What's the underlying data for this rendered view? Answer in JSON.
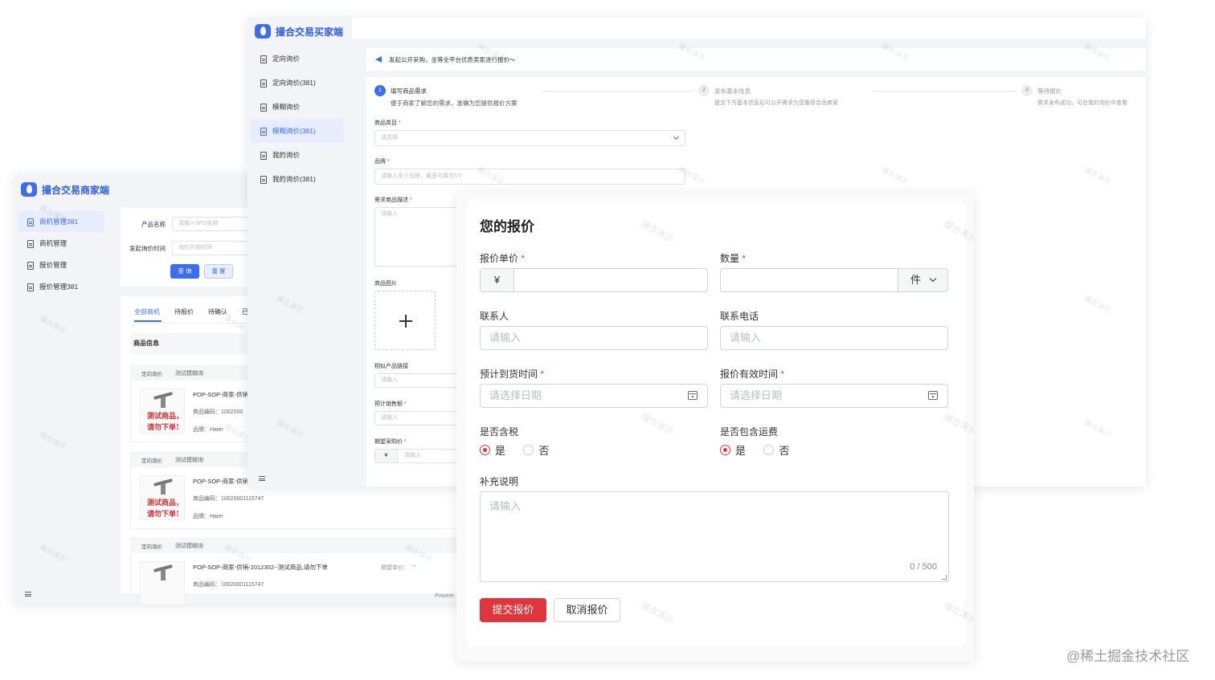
{
  "seller": {
    "brand": "撮合交易商家端",
    "nav": [
      {
        "label": "商机管理381",
        "active": true
      },
      {
        "label": "商机管理",
        "active": false
      },
      {
        "label": "报价管理",
        "active": false
      },
      {
        "label": "报价管理381",
        "active": false
      }
    ],
    "filters": {
      "product_name_label": "产品名称",
      "product_name_placeholder": "请输入SPU名称",
      "time_label": "发起询价时间",
      "time_placeholder": "询价开始时间",
      "query_button": "查 询",
      "reset_button": "重 置"
    },
    "tabs": [
      "全部商机",
      "待报价",
      "待确认",
      "已"
    ],
    "section_title": "商品信息",
    "cards": [
      {
        "tag1": "定向询价",
        "tag2": "测试模糊询",
        "title": "POP-SOP-商家-供销",
        "code": "商品编码：1002000",
        "brand": "品牌：Haier",
        "thumb1": "测试商品，",
        "thumb2": "请勿下单!"
      },
      {
        "tag1": "定向询价",
        "tag2": "测试模糊询",
        "title": "POP-SOP-商家-供销",
        "code": "商品编码：10020001115747",
        "brand": "品牌：Haier",
        "thumb1": "测试商品，",
        "thumb2": "请勿下单!"
      },
      {
        "tag1": "定向询价",
        "tag2": "测试模糊询",
        "title": "POP-SOP-商家-供销-2012302--测试商品,请勿下单",
        "code": "商品编码：10020001115747",
        "price_label": "期望单价：",
        "price_value": "--"
      }
    ],
    "footer_text": "Powere"
  },
  "buyer": {
    "brand": "撮合交易买家端",
    "nav": [
      {
        "label": "定向询价",
        "active": false
      },
      {
        "label": "定向询价(381)",
        "active": false
      },
      {
        "label": "模糊询价",
        "active": false
      },
      {
        "label": "模糊询价(381)",
        "active": true
      },
      {
        "label": "我的询价",
        "active": false
      },
      {
        "label": "我的询价(381)",
        "active": false
      }
    ],
    "notice": "发起公开采购，坐等全平台优质卖家进行报价～",
    "steps": [
      {
        "num": "1",
        "title": "填写商品需求",
        "desc": "便于商家了解您的需求，准确为您提供报价方案",
        "active": true
      },
      {
        "num": "2",
        "title": "发布基本信息",
        "desc": "提交下方基本信息后可公开需求为您推荐合适商家",
        "active": false
      },
      {
        "num": "3",
        "title": "等待报价",
        "desc": "需求发布成功，可在我的询价中查看",
        "active": false
      }
    ],
    "form": {
      "category_label": "商品类目",
      "category_placeholder": "请选择",
      "brand_label": "品牌",
      "brand_placeholder": "请输入多个品牌，最多可填写5个",
      "desc_label": "需求商品描述",
      "desc_placeholder": "请输入",
      "image_label": "商品图片",
      "link_label": "相似产品链接",
      "link_placeholder": "请输入",
      "sales_label": "预计销售额",
      "sales_placeholder": "请输入",
      "price_label": "期望采购价",
      "currency": "¥",
      "price_placeholder": "请输入"
    }
  },
  "quote": {
    "title": "您的报价",
    "unit_price_label": "报价单价",
    "currency": "¥",
    "quantity_label": "数量",
    "unit": "件",
    "contact_label": "联系人",
    "contact_placeholder": "请输入",
    "phone_label": "联系电话",
    "phone_placeholder": "请输入",
    "arrival_label": "预计到货时间",
    "arrival_placeholder": "请选择日期",
    "valid_label": "报价有效时间",
    "valid_placeholder": "请选择日期",
    "tax_label": "是否含税",
    "shipping_label": "是否包含运费",
    "yes": "是",
    "no": "否",
    "remark_label": "补充说明",
    "remark_placeholder": "请输入",
    "counter": "0 / 500",
    "submit": "提交报价",
    "cancel": "取消报价"
  },
  "watermark": "撮合演示",
  "credit": "@稀土掘金技术社区",
  "colors": {
    "primary_blue": "#3a6df0",
    "danger_red": "#e0353b"
  }
}
